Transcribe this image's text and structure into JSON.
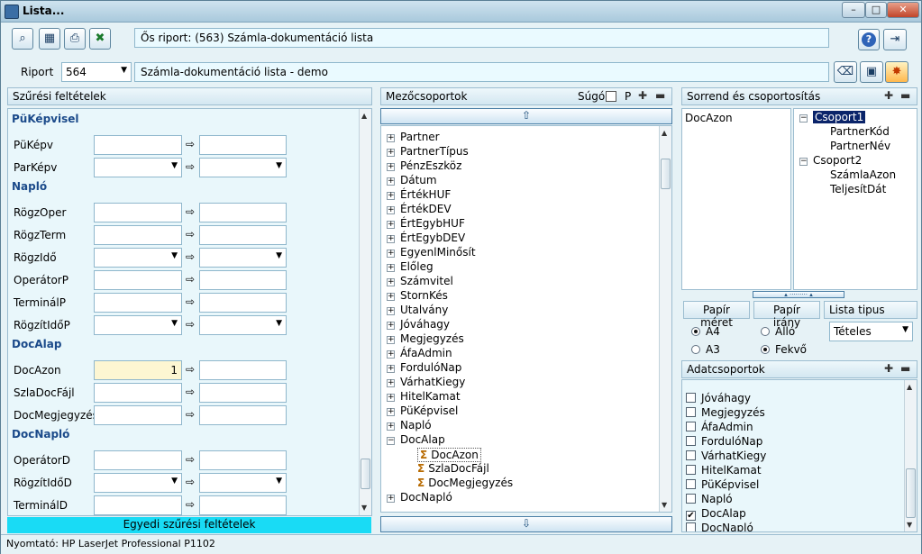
{
  "window": {
    "title": "Lista...",
    "min": "–",
    "max": "□",
    "close": "✕"
  },
  "toolbar": {
    "origin_label": "Ős riport: (563)  Számla-dokumentáció lista",
    "riport_label": "Riport",
    "riport_value": "564",
    "riport_desc": "Számla-dokumentáció lista - demo",
    "help": "?"
  },
  "filters": {
    "title": "Szűrési feltételek",
    "sections": [
      {
        "title": "PüKépvisel",
        "fields": [
          {
            "label": "PüKépv",
            "type": "text",
            "v1": "",
            "v2": ""
          },
          {
            "label": "ParKépv",
            "type": "select",
            "v1": "",
            "v2": ""
          }
        ]
      },
      {
        "title": "Napló",
        "fields": [
          {
            "label": "RögzOper",
            "type": "text",
            "v1": "",
            "v2": ""
          },
          {
            "label": "RögzTerm",
            "type": "text",
            "v1": "",
            "v2": ""
          },
          {
            "label": "RögzIdő",
            "type": "select",
            "v1": "",
            "v2": ""
          },
          {
            "label": "OperátorP",
            "type": "text",
            "v1": "",
            "v2": ""
          },
          {
            "label": "TerminálP",
            "type": "text",
            "v1": "",
            "v2": ""
          },
          {
            "label": "RögzítIdőP",
            "type": "select",
            "v1": "",
            "v2": ""
          }
        ]
      },
      {
        "title": "DocAlap",
        "fields": [
          {
            "label": "DocAzon",
            "type": "text",
            "v1": "1",
            "v2": "",
            "highlight": true
          },
          {
            "label": "SzlaDocFájl",
            "type": "text",
            "v1": "",
            "v2": ""
          },
          {
            "label": "DocMegjegyzés",
            "type": "text",
            "v1": "",
            "v2": ""
          }
        ]
      },
      {
        "title": "DocNapló",
        "fields": [
          {
            "label": "OperátorD",
            "type": "text",
            "v1": "",
            "v2": ""
          },
          {
            "label": "RögzítIdőD",
            "type": "select",
            "v1": "",
            "v2": ""
          },
          {
            "label": "TerminálD",
            "type": "text",
            "v1": "",
            "v2": ""
          }
        ]
      }
    ],
    "custom_button": "Egyedi szűrési feltételek"
  },
  "fields_panel": {
    "title": "Mezőcsoportok",
    "sugo": "Súgó",
    "p": "P",
    "groups": [
      "Partner",
      "PartnerTípus",
      "PénzEszköz",
      "Dátum",
      "ÉrtékHUF",
      "ÉrtékDEV",
      "ÉrtEgybHUF",
      "ÉrtEgybDEV",
      "EgyenlMinősít",
      "Előleg",
      "Számvitel",
      "StornKés",
      "Utalvány",
      "Jóváhagy",
      "Megjegyzés",
      "ÁfaAdmin",
      "FordulóNap",
      "VárhatKiegy",
      "HitelKamat",
      "PüKépvisel",
      "Napló"
    ],
    "expanded": "DocAlap",
    "children": [
      "DocAzon",
      "SzlaDocFájl",
      "DocMegjegyzés"
    ],
    "last": "DocNapló"
  },
  "order_panel": {
    "title": "Sorrend és csoportosítás",
    "order_items": [
      "DocAzon"
    ],
    "groups": [
      {
        "name": "Csoport1",
        "items": [
          "PartnerKód",
          "PartnerNév"
        ]
      },
      {
        "name": "Csoport2",
        "items": [
          "SzámlaAzon",
          "TeljesítDát"
        ]
      }
    ]
  },
  "print": {
    "paper_size": "Papír méret",
    "paper_dir": "Papír irány",
    "list_type": "Lista tipus",
    "a4": "A4",
    "a3": "A3",
    "allo": "Álló",
    "fekvo": "Fekvő",
    "list_value": "Tételes"
  },
  "data_groups": {
    "title": "Adatcsoportok",
    "items": [
      {
        "label": "Jóváhagy",
        "checked": false
      },
      {
        "label": "Megjegyzés",
        "checked": false
      },
      {
        "label": "ÁfaAdmin",
        "checked": false
      },
      {
        "label": "FordulóNap",
        "checked": false
      },
      {
        "label": "VárhatKiegy",
        "checked": false
      },
      {
        "label": "HitelKamat",
        "checked": false
      },
      {
        "label": "PüKépvisel",
        "checked": false
      },
      {
        "label": "Napló",
        "checked": false
      },
      {
        "label": "DocAlap",
        "checked": true
      },
      {
        "label": "DocNapló",
        "checked": false
      }
    ]
  },
  "status": {
    "printer": "Nyomtató: HP LaserJet Professional P1102"
  }
}
